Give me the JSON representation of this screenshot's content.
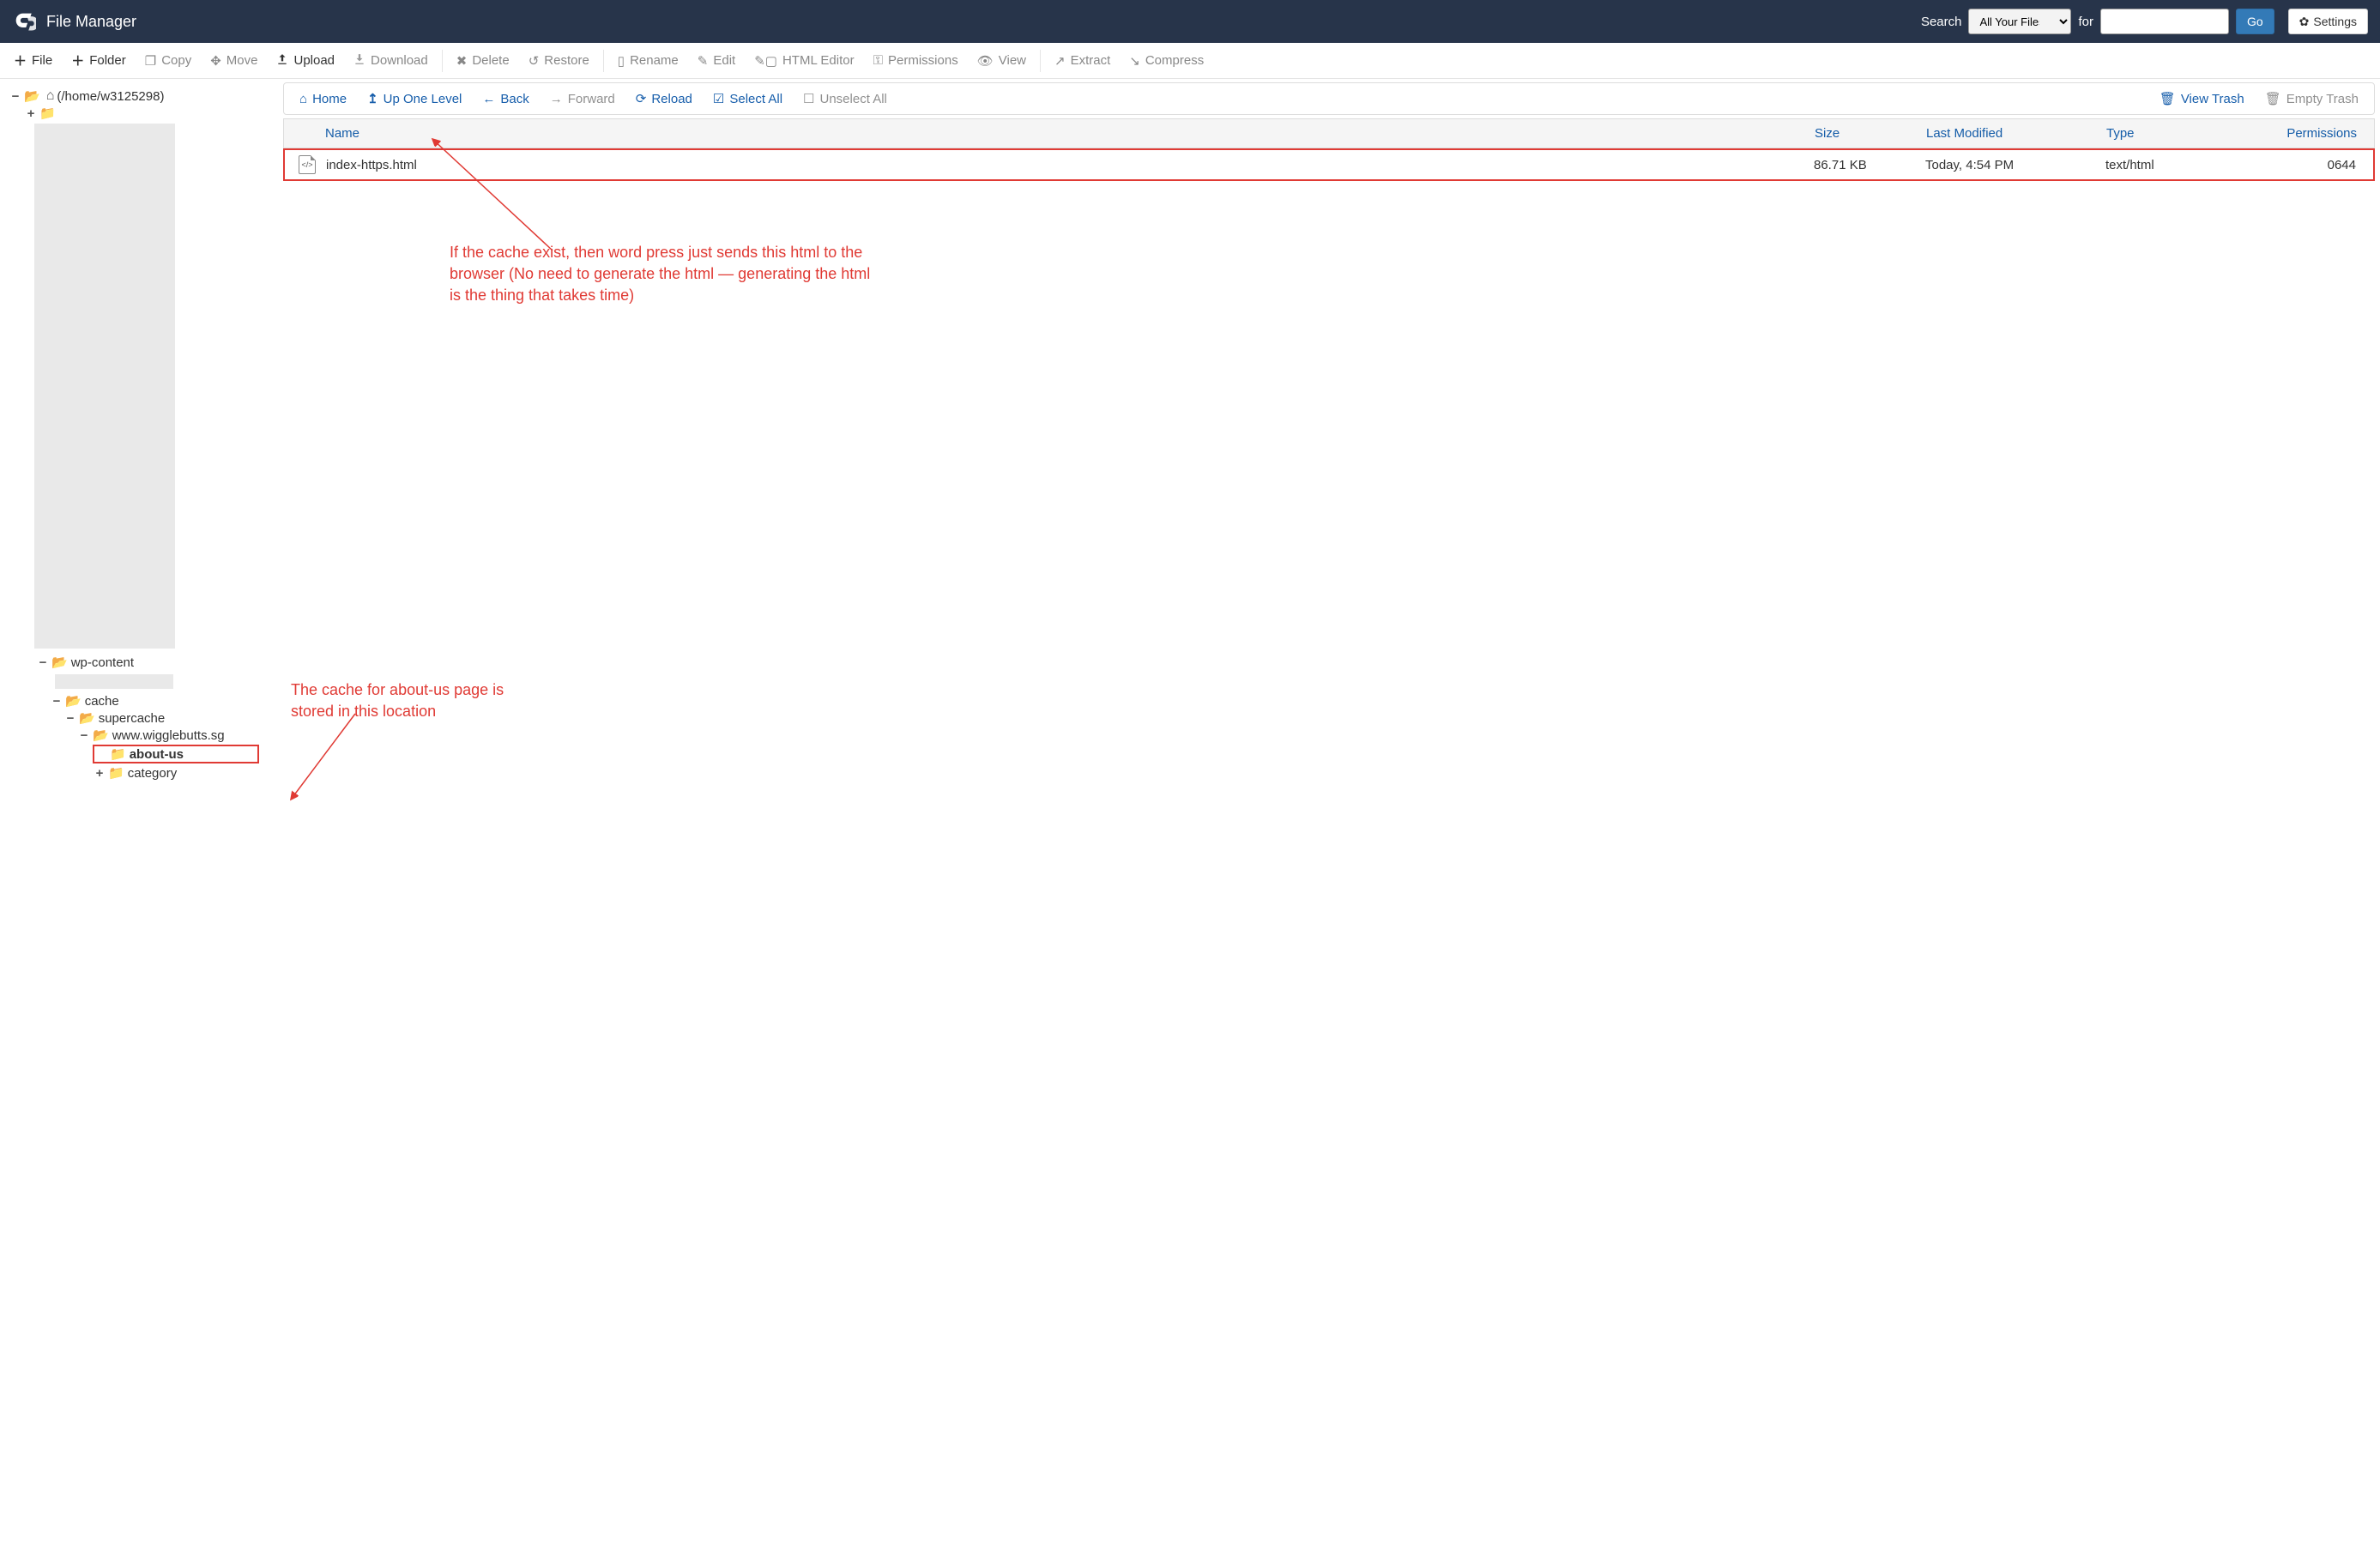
{
  "header": {
    "title": "File Manager",
    "search_label": "Search",
    "search_scope": "All Your Files",
    "for_label": "for",
    "search_input": "",
    "go_btn": "Go",
    "settings_btn": "Settings"
  },
  "toolbar": {
    "file": "File",
    "folder": "Folder",
    "copy": "Copy",
    "move": "Move",
    "upload": "Upload",
    "download": "Download",
    "delete": "Delete",
    "restore": "Restore",
    "rename": "Rename",
    "edit": "Edit",
    "html_editor": "HTML Editor",
    "permissions": "Permissions",
    "view": "View",
    "extract": "Extract",
    "compress": "Compress"
  },
  "actionbar": {
    "home": "Home",
    "up": "Up One Level",
    "back": "Back",
    "forward": "Forward",
    "reload": "Reload",
    "select_all": "Select All",
    "unselect_all": "Unselect All",
    "view_trash": "View Trash",
    "empty_trash": "Empty Trash"
  },
  "tree": {
    "root": "(/home/w3125298)",
    "wp_content": "wp-content",
    "cache": "cache",
    "supercache": "supercache",
    "domain": "www.wigglebutts.sg",
    "about_us": "about-us",
    "category": "category"
  },
  "table": {
    "headers": {
      "name": "Name",
      "size": "Size",
      "modified": "Last Modified",
      "type": "Type",
      "perms": "Permissions"
    },
    "rows": [
      {
        "name": "index-https.html",
        "size": "86.71 KB",
        "modified": "Today, 4:54 PM",
        "type": "text/html",
        "perms": "0644"
      }
    ]
  },
  "annotations": {
    "top": "If the cache exist, then word press just sends this html to the browser (No need to generate the html — generating the html is the thing that takes time)",
    "bottom": "The cache for about-us page is stored in this location"
  }
}
